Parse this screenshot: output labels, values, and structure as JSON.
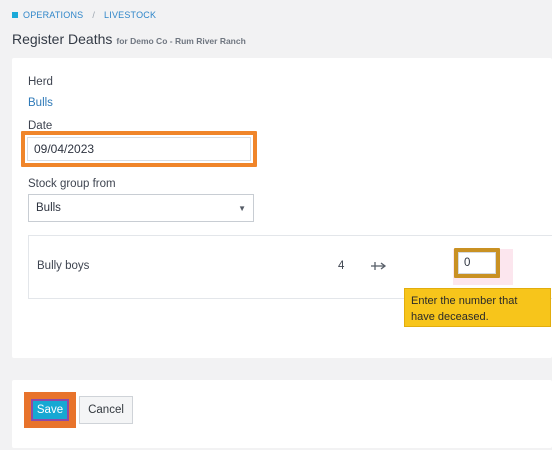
{
  "breadcrumb": {
    "items": [
      "OPERATIONS",
      "LIVESTOCK"
    ],
    "separator": "/"
  },
  "page": {
    "title": "Register Deaths",
    "subtitle": "for Demo Co - Rum River Ranch"
  },
  "form": {
    "herd_label": "Herd",
    "herd_value": "Bulls",
    "date_label": "Date",
    "date_value": "09/04/2023",
    "stock_group_label": "Stock group from",
    "stock_group_value": "Bulls"
  },
  "stock_row": {
    "name": "Bully boys",
    "count": "4",
    "deceased_value": "0"
  },
  "tooltip": {
    "text": "Enter the number that have deceased."
  },
  "footer": {
    "save_label": "Save",
    "cancel_label": "Cancel"
  },
  "colors": {
    "accent": "#16a8d3",
    "highlight_orange": "#f0852a",
    "tooltip_yellow": "#f7c51b"
  },
  "icons": {
    "breadcrumb": "square-icon",
    "dropdown": "caret-down-icon",
    "transfer": "transfer-icon"
  }
}
